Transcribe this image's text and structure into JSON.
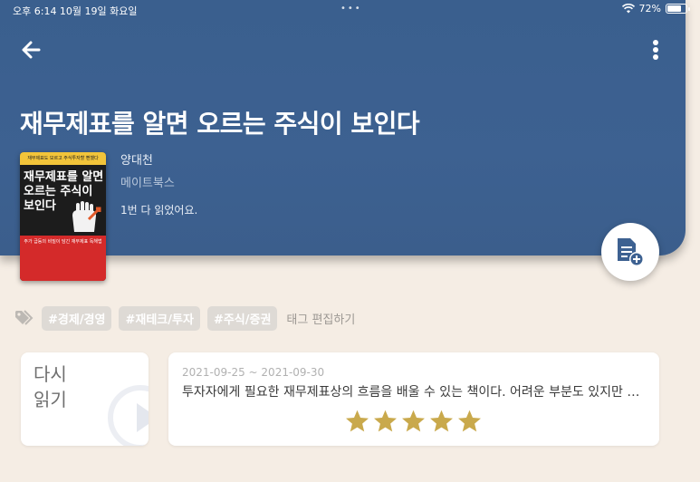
{
  "status_bar": {
    "time": "오후 6:14   10월 19일 화요일",
    "dots": "•••",
    "battery": "72%"
  },
  "header": {
    "title": "재무제표를 알면 오르는 주식이 보인다",
    "author": "양대천",
    "publisher": "메이트북스",
    "read_count": "1번 다 읽었어요."
  },
  "cover": {
    "top_text": "재무제표도 모르고 주식투자할 뻔했다",
    "title": "재무제표를 알면 오르는 주식이 보인다",
    "bottom_text": "주가 급등의 비밀이 담긴 재무제표 독해법"
  },
  "icons": {
    "back": "arrow-left-icon",
    "more": "more-vertical-icon",
    "add_note": "document-add-icon",
    "tags": "tags-icon",
    "play": "play-icon",
    "star": "star-icon"
  },
  "tags": {
    "items": [
      "#경제/경영",
      "#재테크/투자",
      "#주식/증권"
    ],
    "edit_label": "태그 편집하기"
  },
  "reread": {
    "label": "다시 읽기"
  },
  "review": {
    "date_range": "2021-09-25 ~ 2021-09-30",
    "text": "투자자에게 필요한 재무제표상의 흐름을 배울 수 있는 책이다. 어려운 부분도 있지만 친절한 설명 덕분에 끝까지 읽을 수 있었다.",
    "rating": 5,
    "rating_max": 5
  },
  "colors": {
    "header_blue": "#3d6191",
    "background": "#f5ede4",
    "star": "#c9a94c",
    "tag_bg": "#dedad5"
  }
}
